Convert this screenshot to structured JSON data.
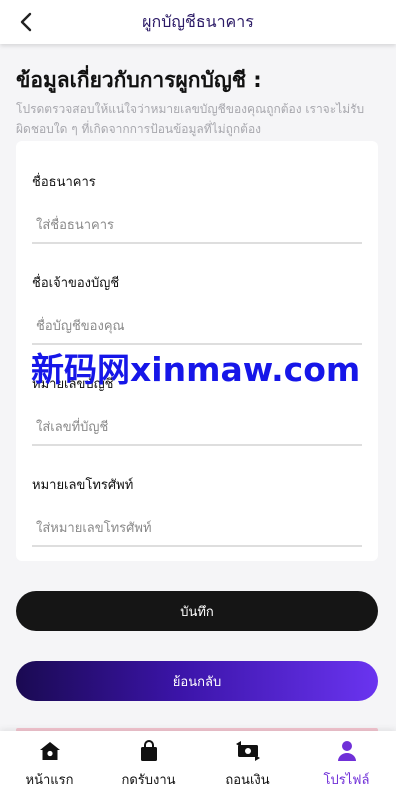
{
  "header": {
    "title": "ผูกบัญชีธนาคาร",
    "back_icon": "chevron-left-icon"
  },
  "section": {
    "title": "ข้อมูลเกี่ยวกับการผูกบัญชี :",
    "note": "โปรดตรวจสอบให้แน่ใจว่าหมายเลขบัญชีของคุณถูกต้อง เราจะไม่รับ ผิดชอบใด ๆ ที่เกิดจากการป้อนข้อมูลที่ไม่ถูกต้อง"
  },
  "form": {
    "bank_name": {
      "label": "ชื่อธนาคาร",
      "placeholder": "ใส่ชื่อธนาคาร"
    },
    "account_owner": {
      "label": "ชื่อเจ้าของบัญชี",
      "placeholder": "ชื่อบัญชีของคุณ"
    },
    "account_number": {
      "label": "หมายเลขบัญชี",
      "placeholder": "ใส่เลขที่บัญชี"
    },
    "phone": {
      "label": "หมายเลขโทรศัพท์",
      "placeholder": "ใส่หมายเลขโทรศัพท์"
    }
  },
  "buttons": {
    "save": "บันทึก",
    "back": "ย้อนกลับ"
  },
  "watermark": "新码网xinmaw.com",
  "nav": [
    {
      "label": "หน้าแรก",
      "icon": "home-icon"
    },
    {
      "label": "กดรับงาน",
      "icon": "bag-icon"
    },
    {
      "label": "ถอนเงิน",
      "icon": "money-exchange-icon"
    },
    {
      "label": "โปรไฟล์",
      "icon": "user-icon",
      "active": true
    }
  ],
  "colors": {
    "accent": "#7030d8",
    "dark_button": "#151515",
    "header_title": "#2b1a66"
  }
}
